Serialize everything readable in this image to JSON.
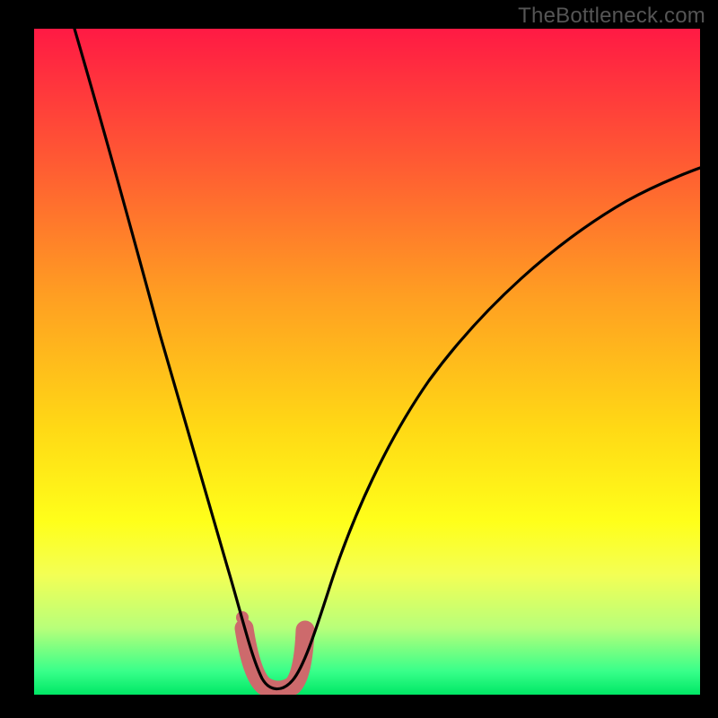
{
  "watermark": "TheBottleneck.com",
  "colors": {
    "page_bg": "#000000",
    "curve": "#000000",
    "highlight": "#cd6a6c",
    "gradient_stops": [
      {
        "pos": 0.0,
        "hex": "#ff1a44"
      },
      {
        "pos": 0.2,
        "hex": "#ff5a33"
      },
      {
        "pos": 0.4,
        "hex": "#ff9e22"
      },
      {
        "pos": 0.6,
        "hex": "#ffd915"
      },
      {
        "pos": 0.74,
        "hex": "#ffff1a"
      },
      {
        "pos": 0.82,
        "hex": "#f3ff55"
      },
      {
        "pos": 0.9,
        "hex": "#b8ff7a"
      },
      {
        "pos": 0.965,
        "hex": "#38ff8a"
      },
      {
        "pos": 1.0,
        "hex": "#00e765"
      }
    ]
  },
  "chart_data": {
    "type": "line",
    "title": "",
    "xlabel": "",
    "ylabel": "",
    "xlim": [
      0,
      100
    ],
    "ylim": [
      0,
      100
    ],
    "grid": false,
    "note": "Values are read from the curve in image-space as percent of plot width/height; y=0 is bottom. The curve is a V-shaped bottleneck profile with minimum near x≈36.",
    "series": [
      {
        "name": "bottleneck-curve",
        "x": [
          0,
          4,
          8,
          12,
          16,
          20,
          24,
          28,
          31,
          33,
          35,
          36,
          37,
          38,
          40,
          42,
          44,
          48,
          52,
          56,
          62,
          70,
          80,
          90,
          100
        ],
        "y": [
          100,
          90,
          80,
          70,
          60,
          50,
          40,
          28,
          16,
          8,
          2,
          0.5,
          0.5,
          2,
          6,
          12,
          18,
          28,
          37,
          44,
          52,
          60,
          66,
          71,
          75
        ]
      }
    ],
    "highlight_region": {
      "name": "valley-highlight",
      "description": "Thick salmon-colored U segment near curve minimum, with one detached dot on the left above the U.",
      "x_range": [
        31.5,
        40.5
      ],
      "y_range": [
        0,
        10
      ],
      "dot": {
        "x": 31.3,
        "y": 11.5,
        "r_pct": 0.8
      }
    }
  }
}
